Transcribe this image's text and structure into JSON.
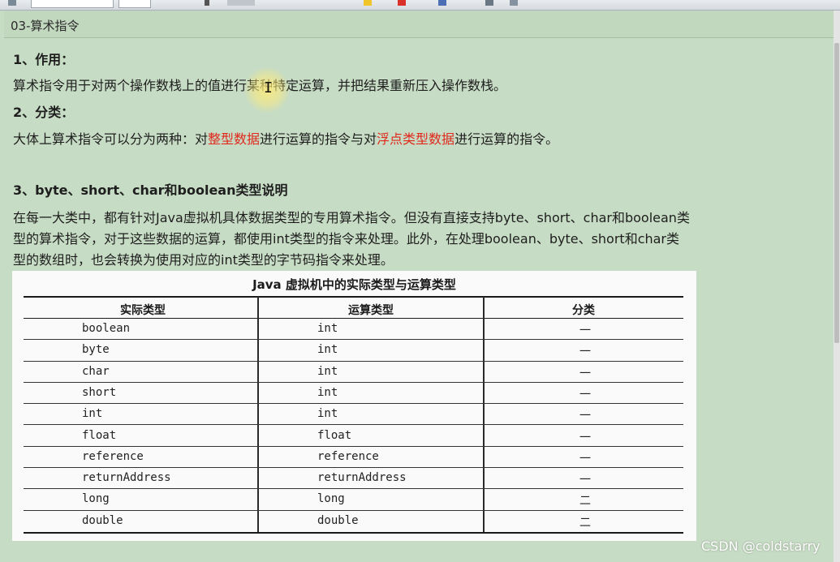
{
  "note": {
    "title": "03-算术指令",
    "section1": {
      "heading": "1、作用：",
      "text": "算术指令用于对两个操作数栈上的值进行某种特定运算，并把结果重新压入操作数栈。"
    },
    "section2": {
      "heading": "2、分类：",
      "text_a": "大体上算术指令可以分为两种：对",
      "highlight_a": "整型数据",
      "text_b": "进行运算的指令与对",
      "highlight_b": "浮点类型数据",
      "text_c": "进行运算的指令。"
    },
    "section3": {
      "heading": "3、byte、short、char和boolean类型说明",
      "line1": "在每一大类中，都有针对Java虚拟机具体数据类型的专用算术指令。但没有直接支持byte、short、char和boolean类",
      "line2": "型的算术指令，对于这些数据的运算，都使用int类型的指令来处理。此外，在处理boolean、byte、short和char类",
      "line3": "型的数组时，也会转换为使用对应的int类型的字节码指令来处理。"
    }
  },
  "table": {
    "caption": "Java 虚拟机中的实际类型与运算类型",
    "headers": [
      "实际类型",
      "运算类型",
      "分类"
    ],
    "rows": [
      [
        "boolean",
        "int",
        "一"
      ],
      [
        "byte",
        "int",
        "一"
      ],
      [
        "char",
        "int",
        "一"
      ],
      [
        "short",
        "int",
        "一"
      ],
      [
        "int",
        "int",
        "一"
      ],
      [
        "float",
        "float",
        "一"
      ],
      [
        "reference",
        "reference",
        "一"
      ],
      [
        "returnAddress",
        "returnAddress",
        "一"
      ],
      [
        "long",
        "long",
        "二"
      ],
      [
        "double",
        "double",
        "二"
      ]
    ]
  },
  "watermark": "CSDN @coldstarry",
  "colors": {
    "background": "#c7dcc4",
    "highlight_red": "#e0281c"
  }
}
